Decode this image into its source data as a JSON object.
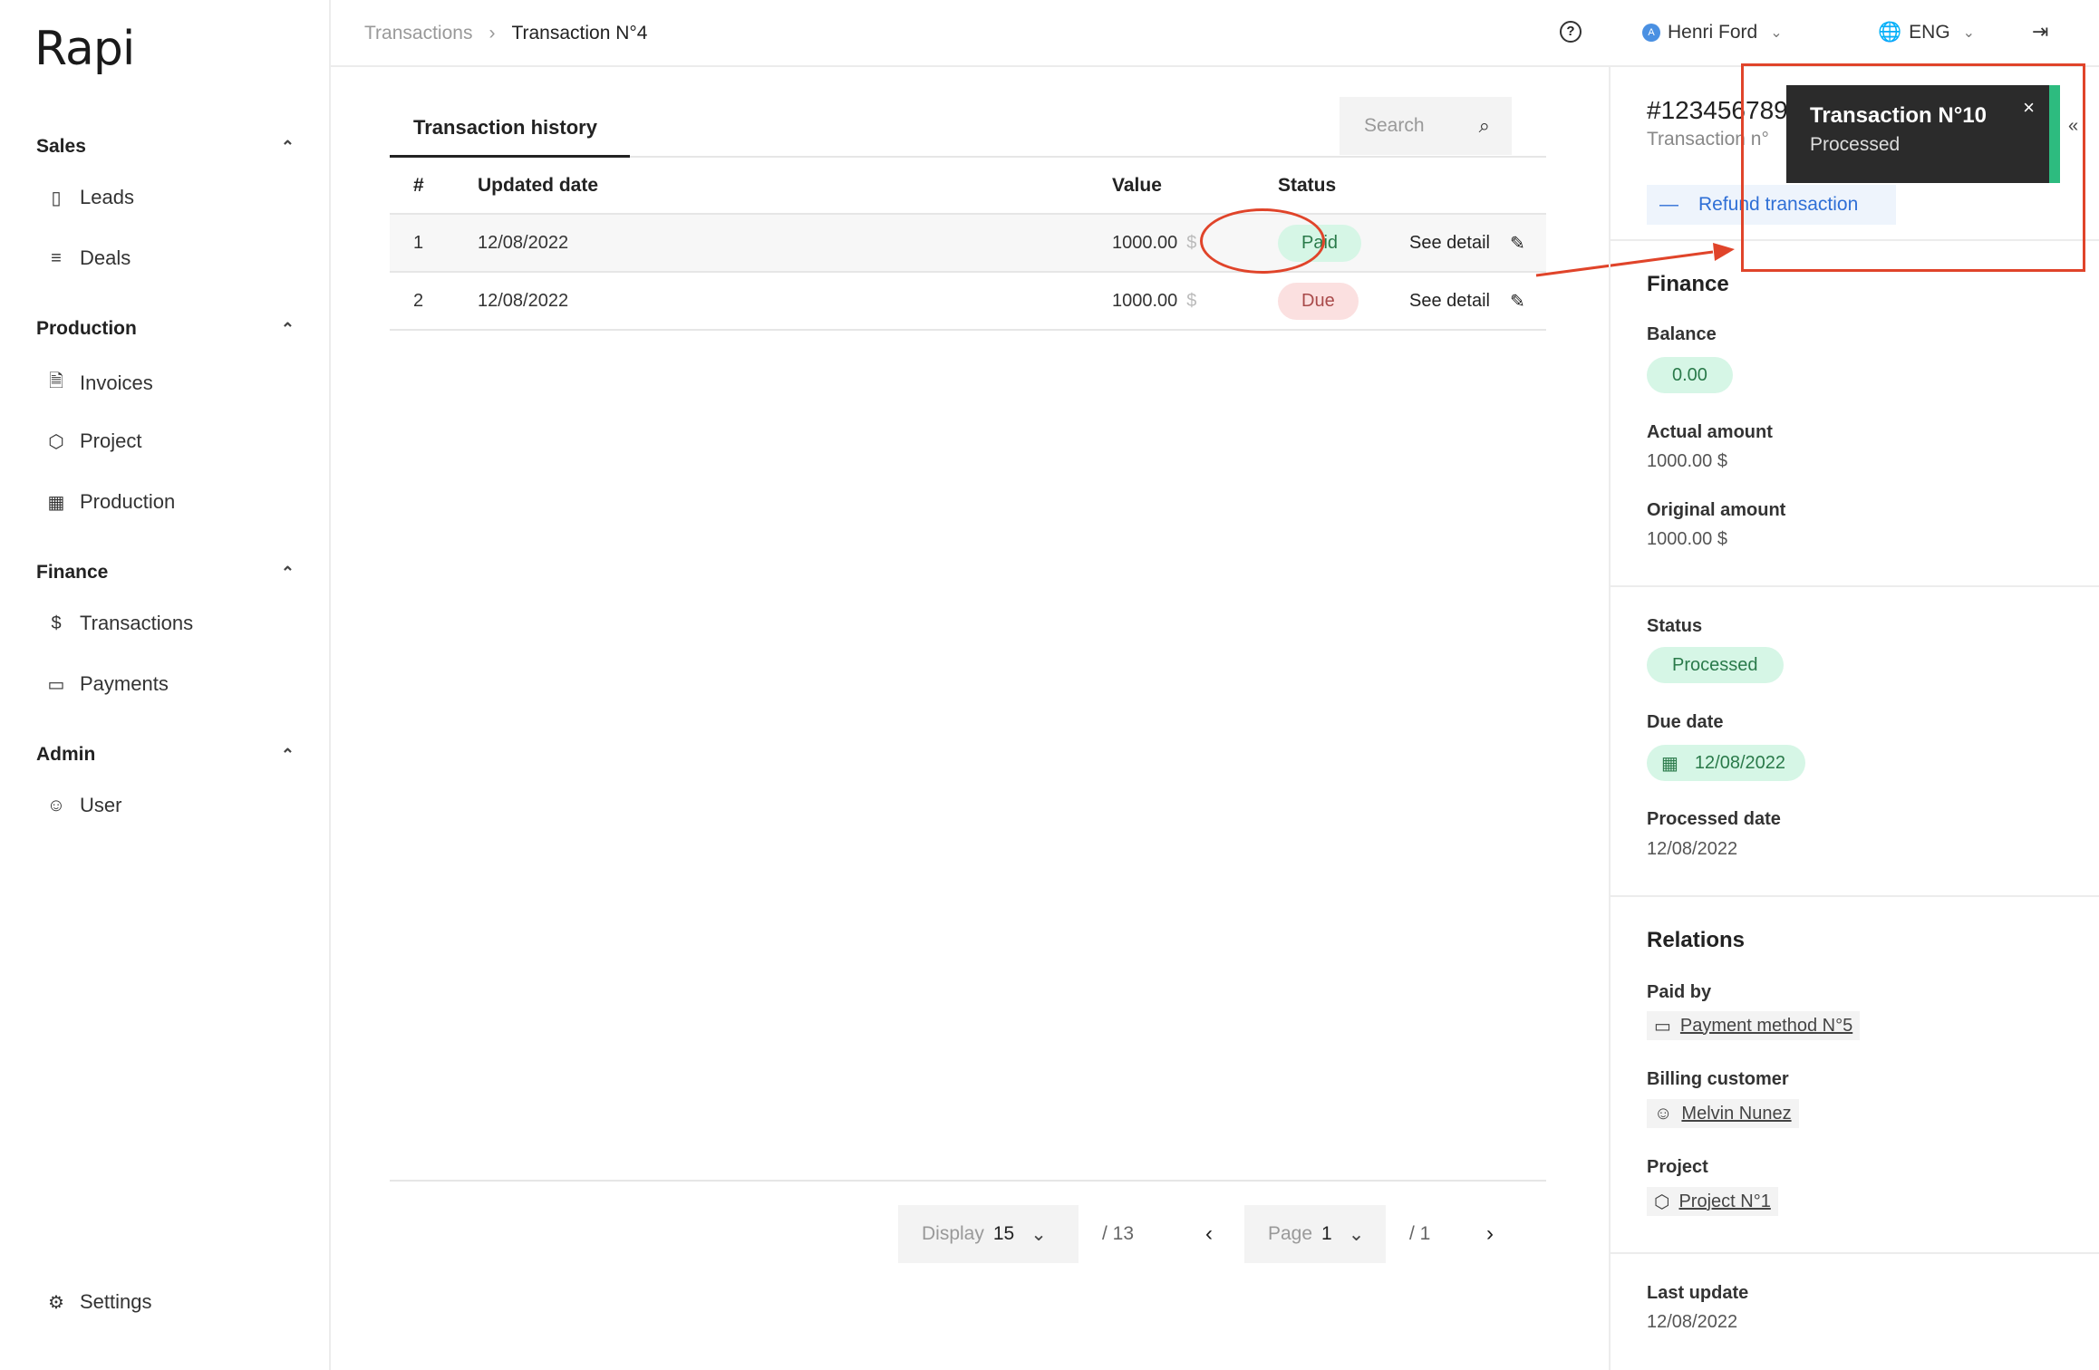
{
  "sidebar": {
    "logo": "Rapi",
    "sections": [
      {
        "title": "Sales",
        "items": [
          {
            "label": "Leads",
            "icon": "book-icon"
          },
          {
            "label": "Deals",
            "icon": "list-icon"
          }
        ]
      },
      {
        "title": "Production",
        "items": [
          {
            "label": "Invoices",
            "icon": "document-icon"
          },
          {
            "label": "Project",
            "icon": "box-icon"
          },
          {
            "label": "Production",
            "icon": "calendar-icon"
          }
        ]
      },
      {
        "title": "Finance",
        "items": [
          {
            "label": "Transactions",
            "icon": "dollar-icon"
          },
          {
            "label": "Payments",
            "icon": "card-icon"
          }
        ]
      },
      {
        "title": "Admin",
        "items": [
          {
            "label": "User",
            "icon": "user-icon"
          }
        ]
      }
    ],
    "settings": "Settings"
  },
  "topbar": {
    "breadcrumb_parent": "Transactions",
    "breadcrumb_current": "Transaction N°4",
    "user_initial": "A",
    "user_name": "Henri Ford",
    "language": "ENG"
  },
  "main": {
    "tab": "Transaction history",
    "search_placeholder": "Search",
    "columns": [
      "#",
      "Updated date",
      "Value",
      "Status"
    ],
    "rows": [
      {
        "num": "1",
        "date": "12/08/2022",
        "value": "1000.00",
        "currency": "$",
        "status": "Paid",
        "action": "See detail"
      },
      {
        "num": "2",
        "date": "12/08/2022",
        "value": "1000.00",
        "currency": "$",
        "status": "Due",
        "action": "See detail"
      }
    ],
    "pagination": {
      "display_label": "Display",
      "display_value": "15",
      "total": "/ 13",
      "page_label": "Page",
      "page_value": "1",
      "page_total": "/ 1"
    }
  },
  "panel": {
    "id": "#123456789",
    "subtitle": "Transaction n°",
    "refund": "Refund transaction",
    "finance_title": "Finance",
    "balance_label": "Balance",
    "balance_value": "0.00",
    "actual_label": "Actual amount",
    "actual_value": "1000.00 $",
    "original_label": "Original amount",
    "original_value": "1000.00 $",
    "status_label": "Status",
    "status_value": "Processed",
    "due_label": "Due date",
    "due_value": "12/08/2022",
    "processed_label": "Processed date",
    "processed_value": "12/08/2022",
    "relations_title": "Relations",
    "paid_by_label": "Paid by",
    "paid_by_value": "Payment method N°5",
    "billing_label": "Billing customer",
    "billing_value": "Melvin Nunez",
    "project_label": "Project",
    "project_value": "Project N°1",
    "last_update_label": "Last update",
    "last_update_value": "12/08/2022"
  },
  "toast": {
    "title": "Transaction N°10",
    "subtitle": "Processed",
    "accent": "#2dbb7f"
  },
  "colors": {
    "annotation": "#e0442a",
    "paid_bg": "#d6f6e6",
    "due_bg": "#fbe0e0",
    "link": "#2f6fd6"
  }
}
